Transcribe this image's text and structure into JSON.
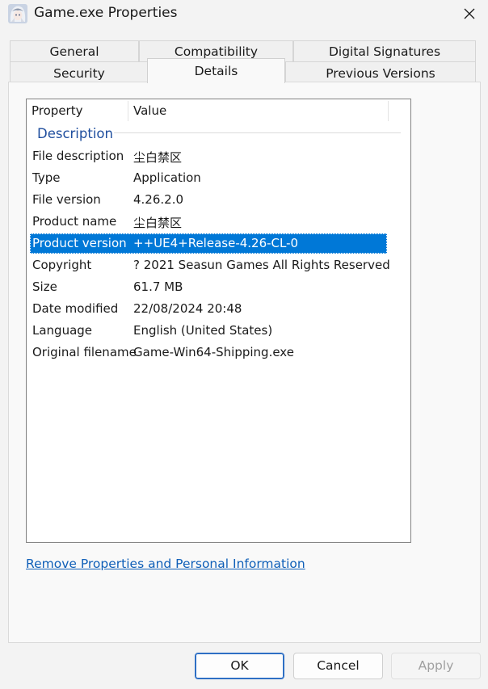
{
  "window": {
    "title": "Game.exe Properties",
    "icon": "anime-character-app-icon",
    "close_icon": "close-icon"
  },
  "tabs": {
    "row1": [
      "General",
      "Compatibility",
      "Digital Signatures"
    ],
    "row2": [
      "Security",
      "Details",
      "Previous Versions"
    ],
    "active": "Details"
  },
  "details": {
    "columns": [
      "Property",
      "Value"
    ],
    "group": "Description",
    "rows": [
      {
        "property": "File description",
        "value": "尘白禁区"
      },
      {
        "property": "Type",
        "value": "Application"
      },
      {
        "property": "File version",
        "value": "4.26.2.0"
      },
      {
        "property": "Product name",
        "value": "尘白禁区"
      },
      {
        "property": "Product version",
        "value": "++UE4+Release-4.26-CL-0"
      },
      {
        "property": "Copyright",
        "value": "? 2021 Seasun Games All Rights Reserved"
      },
      {
        "property": "Size",
        "value": "61.7 MB"
      },
      {
        "property": "Date modified",
        "value": "22/08/2024 20:48"
      },
      {
        "property": "Language",
        "value": "English (United States)"
      },
      {
        "property": "Original filename",
        "value": "Game-Win64-Shipping.exe"
      }
    ],
    "selected_row": "Product version"
  },
  "links": {
    "remove_properties": "Remove Properties and Personal Information"
  },
  "buttons": {
    "ok": "OK",
    "cancel": "Cancel",
    "apply": "Apply"
  },
  "colors": {
    "selection": "#0078d7",
    "group_label": "#1f4e9e",
    "link": "#0f5fb8",
    "window_bg": "#f3f3f3"
  }
}
